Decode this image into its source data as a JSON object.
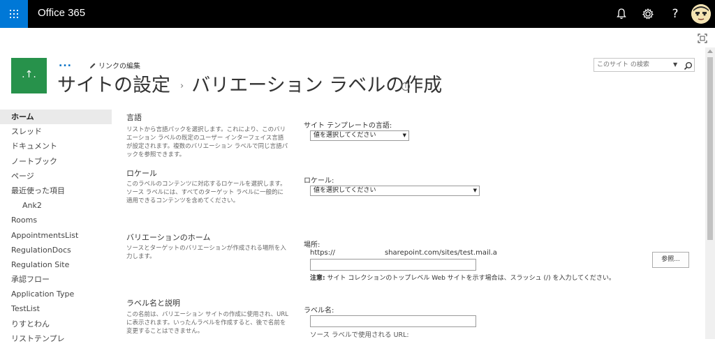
{
  "suite_bar": {
    "app_name": "Office 365",
    "icons": [
      "app-launcher-icon",
      "bell-icon",
      "gear-icon",
      "help-icon",
      "avatar"
    ],
    "help_glyph": "?"
  },
  "header": {
    "ellipsis": "...",
    "edit_links_label": "リンクの編集",
    "logo_glyph": ".↑.",
    "breadcrumb_site": "サイトの設定",
    "breadcrumb_separator": "›",
    "page_title": "バリエーション ラベルの作成",
    "info_glyph": "i",
    "search_placeholder": "このサイト の検索",
    "search_dropdown_glyph": "▼"
  },
  "left_nav": {
    "items": [
      {
        "label": "ホーム",
        "selected": true
      },
      {
        "label": "スレッド"
      },
      {
        "label": "ドキュメント"
      },
      {
        "label": "ノートブック"
      },
      {
        "label": "ページ"
      },
      {
        "label": "最近使った項目"
      },
      {
        "label": "Ank2",
        "sub": true
      },
      {
        "label": "Rooms"
      },
      {
        "label": "AppointmentsList"
      },
      {
        "label": "RegulationDocs"
      },
      {
        "label": "Regulation Site"
      },
      {
        "label": "承認フロー"
      },
      {
        "label": "Application Type"
      },
      {
        "label": "TestList"
      },
      {
        "label": "りすとわん"
      },
      {
        "label": "リストテンプレ"
      }
    ]
  },
  "form": {
    "language": {
      "title": "言語",
      "description": "リストから言語パックを選択します。これにより、このバリエーション ラベルの既定のユーザー インターフェイス言語が設定されます。複数のバリエーション ラベルで同じ言語パックを参照できます。",
      "field_label": "サイト テンプレートの言語:",
      "select_value": "値を選択してください"
    },
    "locale": {
      "title": "ロケール",
      "description": "このラベルのコンテンツに対応するロケールを選択します。ソース ラベルには、すべてのターゲット ラベルに一般的に適用できるコンテンツを含めてください。",
      "field_label": "ロケール:",
      "select_value": "値を選択してください"
    },
    "variation_home": {
      "title": "バリエーションのホーム",
      "description": "ソースとターゲットのバリエーションが作成される場所を入力します。",
      "field_label": "場所:",
      "url_prefix": "https://",
      "url_suffix": "sharepoint.com/sites/test.mail.a",
      "input_value": "",
      "browse_button": "参照...",
      "note_bold": "注意:",
      "note_text": " サイト コレクションのトップレベル Web サイトを示す場合は、スラッシュ (/) を入力してください。"
    },
    "label_name": {
      "title": "ラベル名と説明",
      "description": "この名前は、バリエーション サイトの作成に使用され、URL に表示されます。いったんラベルを作成すると、後で名前を変更することはできません。",
      "field_label": "ラベル名:",
      "input_value": "",
      "source_label_url": "ソース ラベルで使用される URL:"
    }
  },
  "select_arrow_glyph": "▼",
  "colors": {
    "suite_bar": "#000000",
    "app_launcher": "#0078d7",
    "site_logo": "#27924b",
    "link": "#0072c6"
  }
}
